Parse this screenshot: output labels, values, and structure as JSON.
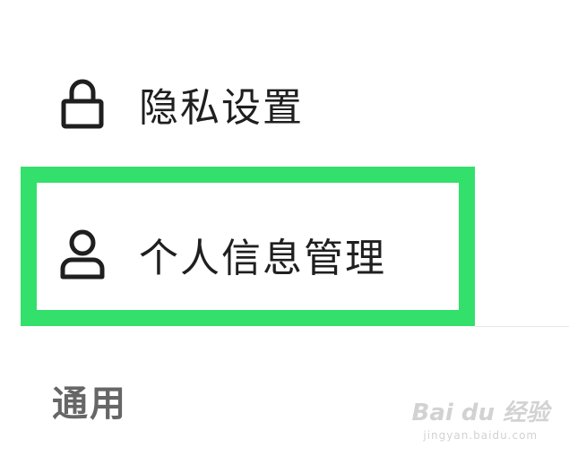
{
  "menu": {
    "privacy": {
      "label": "隐私设置",
      "icon": "lock-icon"
    },
    "personal_info": {
      "label": "个人信息管理",
      "icon": "person-icon",
      "highlighted": true
    }
  },
  "section": {
    "general_header": "通用"
  },
  "watermark": {
    "brand": "Bai du 经验",
    "url": "jingyan.baidu.com"
  },
  "colors": {
    "highlight": "#33e06b",
    "text_primary": "#1f1f1f",
    "text_secondary": "#666666"
  }
}
